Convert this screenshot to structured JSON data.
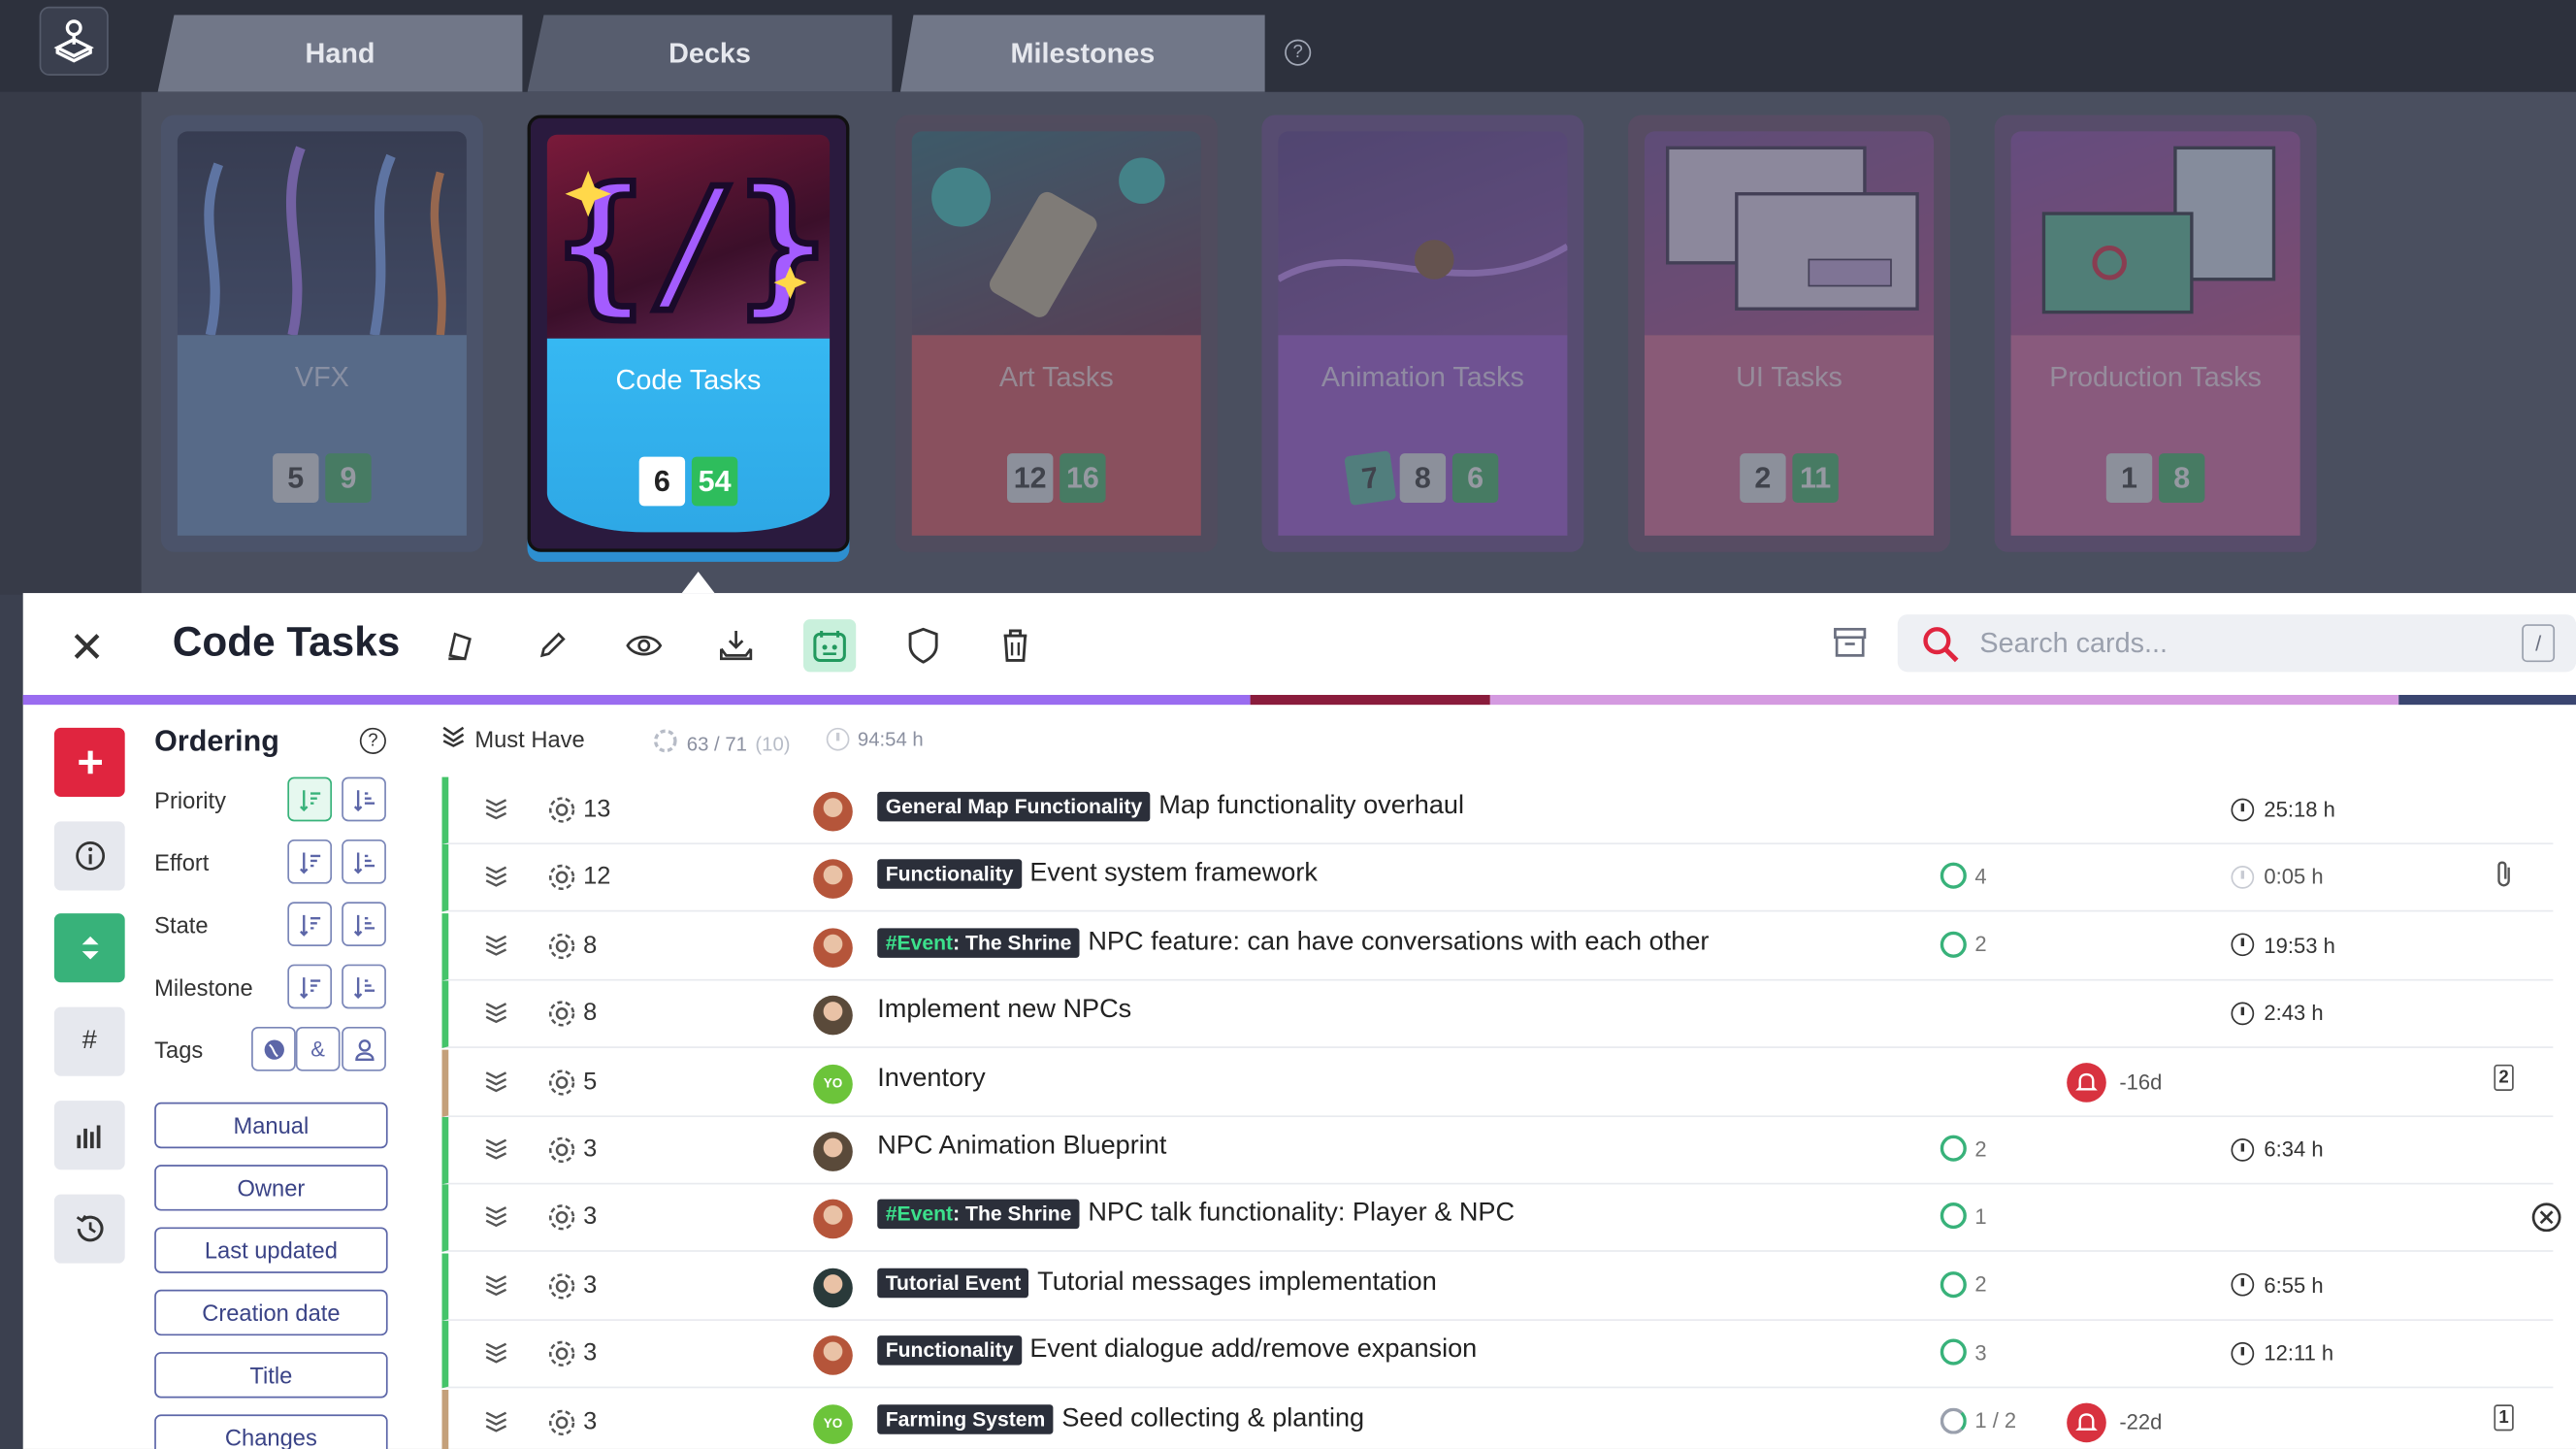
{
  "tabs": [
    {
      "label": "Hand"
    },
    {
      "label": "Decks"
    },
    {
      "label": "Milestones"
    }
  ],
  "tab_help": "?",
  "decks": [
    {
      "name": "VFX",
      "count_a": "5",
      "count_b": "9",
      "selected": false
    },
    {
      "name": "Code Tasks",
      "count_a": "6",
      "count_b": "54",
      "selected": true
    },
    {
      "name": "Art Tasks",
      "count_a": "12",
      "count_b": "16",
      "selected": false
    },
    {
      "name": "Animation Tasks",
      "count_pre": "7",
      "count_a": "8",
      "count_b": "6",
      "selected": false
    },
    {
      "name": "UI Tasks",
      "count_a": "2",
      "count_b": "11",
      "selected": false
    },
    {
      "name": "Production Tasks",
      "count_a": "1",
      "count_b": "8",
      "selected": false
    }
  ],
  "panel": {
    "title": "Code Tasks",
    "search_placeholder": "Search cards...",
    "search_key": "/"
  },
  "ordering": {
    "title": "Ordering",
    "help": "?",
    "rows": [
      "Priority",
      "Effort",
      "State",
      "Milestone",
      "Tags"
    ],
    "buttons": [
      "Manual",
      "Owner",
      "Last updated",
      "Creation date",
      "Title",
      "Changes"
    ]
  },
  "group": {
    "label": "Must Have",
    "effort": "63 / 71",
    "effort_extra": "(10)",
    "time": "94:54 h"
  },
  "tasks": [
    {
      "effort": "13",
      "tag": "General Map Functionality",
      "title": "Map functionality overhaul",
      "sub": "",
      "time": "25:18 h",
      "due": "",
      "extra": ""
    },
    {
      "effort": "12",
      "tag": "Functionality",
      "title": "Event system framework",
      "sub": "4",
      "time": "0:05 h",
      "due": "",
      "extra": "attachment"
    },
    {
      "effort": "8",
      "tag_prefix": "#Event",
      "tag": ": The Shrine",
      "title": "NPC feature: can have conversations with each other",
      "sub": "2",
      "time": "19:53 h",
      "due": "",
      "extra": ""
    },
    {
      "effort": "8",
      "tag": "",
      "title": "Implement new NPCs",
      "sub": "",
      "time": "2:43 h",
      "due": "",
      "extra": ""
    },
    {
      "effort": "5",
      "tag": "",
      "title": "Inventory",
      "sub": "",
      "time": "",
      "due": "-16d",
      "extra": "2",
      "avatar_text": "YO"
    },
    {
      "effort": "3",
      "tag": "",
      "title": "NPC Animation Blueprint",
      "sub": "2",
      "time": "6:34 h",
      "due": "",
      "extra": ""
    },
    {
      "effort": "3",
      "tag_prefix": "#Event",
      "tag": ": The Shrine",
      "title": "NPC talk functionality: Player & NPC",
      "sub": "1",
      "time": "",
      "due": "",
      "extra": "blocked"
    },
    {
      "effort": "3",
      "tag": "Tutorial Event",
      "title": "Tutorial messages implementation",
      "sub": "2",
      "time": "6:55 h",
      "due": "",
      "extra": ""
    },
    {
      "effort": "3",
      "tag": "Functionality",
      "title": "Event dialogue add/remove expansion",
      "sub": "3",
      "time": "12:11 h",
      "due": "",
      "extra": ""
    },
    {
      "effort": "3",
      "tag": "Farming System",
      "title": "Seed collecting & planting",
      "sub": "1 / 2",
      "time": "",
      "due": "-22d",
      "extra": "1",
      "avatar_text": "YO"
    }
  ],
  "colors": {
    "accent_green": "#38b27a",
    "danger_red": "#e0253f",
    "selected_deck": "#35b6f0",
    "text_dark": "#1e2230"
  }
}
